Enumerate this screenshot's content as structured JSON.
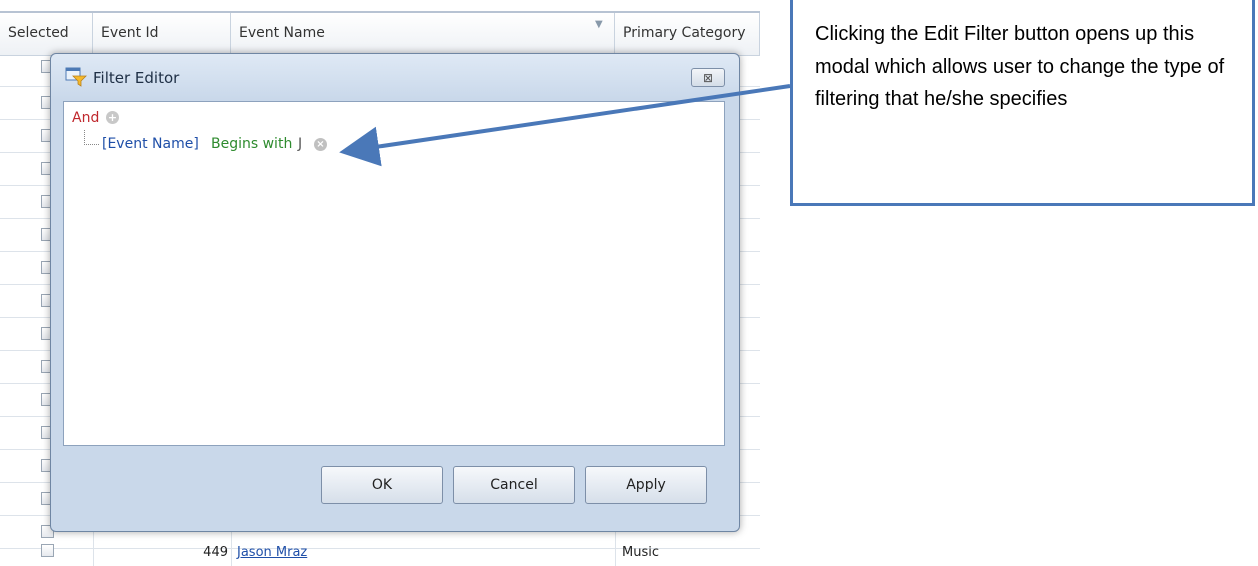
{
  "grid": {
    "columns": [
      "Selected",
      "Event Id",
      "Event Name",
      "Primary Category"
    ],
    "last_row": {
      "id": "449",
      "name": "Jason Mraz",
      "category": "Music"
    }
  },
  "modal": {
    "title": "Filter Editor",
    "close_glyph": "⊠",
    "root_operator": "And",
    "condition": {
      "field": "[Event Name]",
      "operator": "Begins with",
      "value": "J"
    },
    "buttons": {
      "ok": "OK",
      "cancel": "Cancel",
      "apply": "Apply"
    }
  },
  "callout": {
    "text": "Clicking the Edit Filter button opens up this modal which allows user to change the type of filtering that he/she specifies"
  },
  "colors": {
    "callout_border": "#4a78b8",
    "operator_red": "#c0282d",
    "condition_green": "#2e8b2e",
    "field_blue": "#1f4fa8"
  }
}
